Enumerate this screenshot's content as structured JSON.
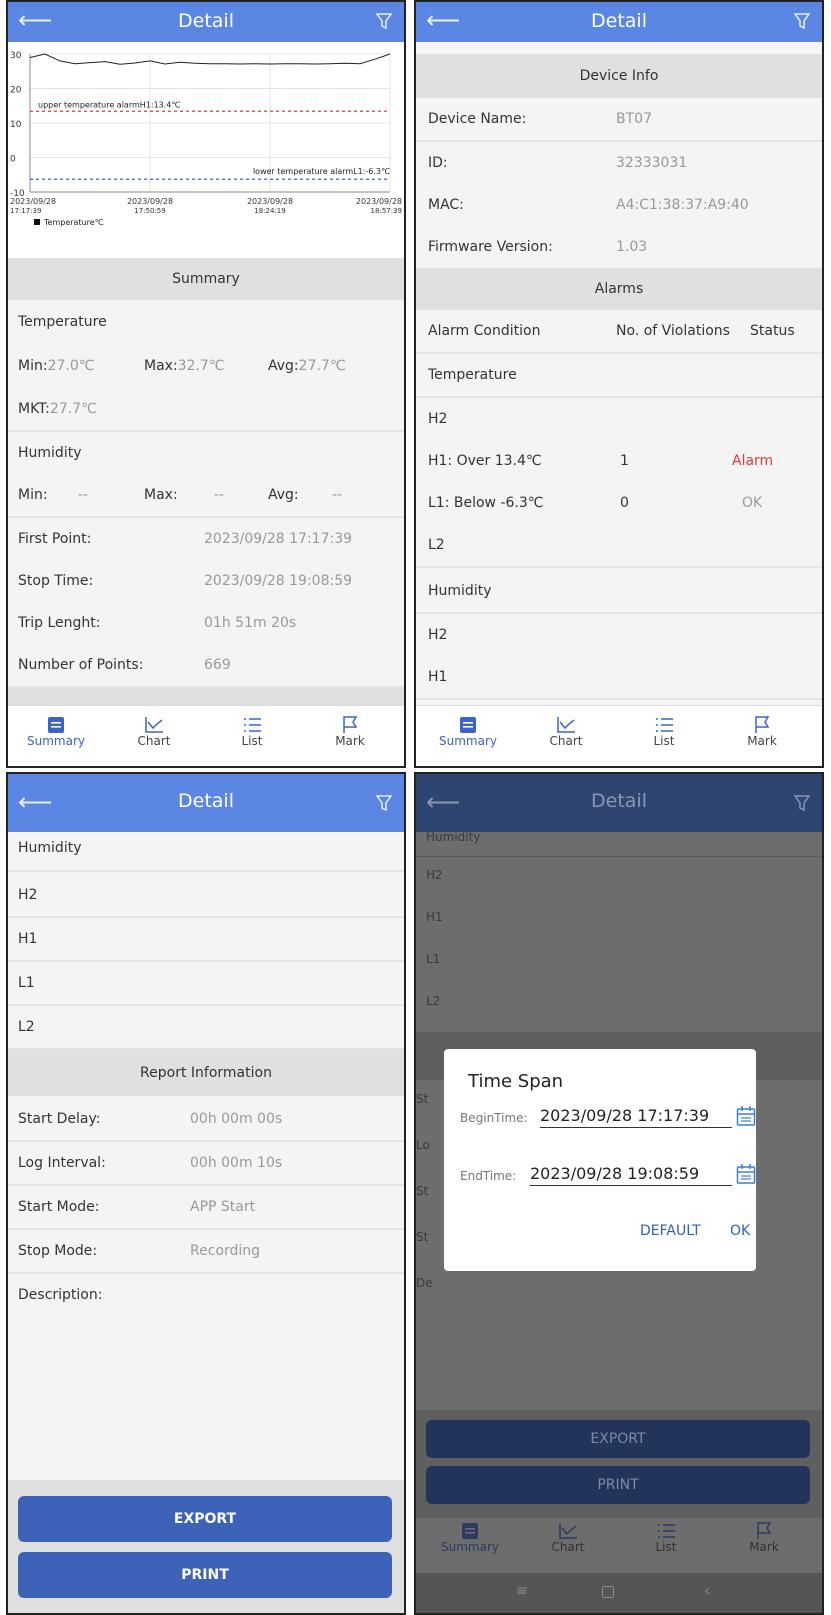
{
  "header": {
    "title": "Detail",
    "back_icon": "arrow-left-icon",
    "filter_icon": "filter-icon",
    "bg": "#5b86e3"
  },
  "chart_data": {
    "type": "line",
    "yticks": [
      "30",
      "20",
      "10",
      "0",
      "-10"
    ],
    "ylim": [
      -10,
      30
    ],
    "x_ticks": [
      {
        "date": "2023/09/28",
        "time": "17:17:39"
      },
      {
        "date": "2023/09/28",
        "time": "17:50:59"
      },
      {
        "date": "2023/09/28",
        "time": "18:24:19"
      },
      {
        "date": "2023/09/28",
        "time": "18:57:39"
      }
    ],
    "upper_alarm_label": "upper temperature alarmH1:13.4℃",
    "upper_alarm_value": 13.4,
    "lower_alarm_label": "lower temperature alarmL1:-6.3℃",
    "lower_alarm_value": -6.3,
    "legend": "Temperature℃",
    "series": [
      {
        "name": "Temperature℃",
        "values": [
          29,
          30,
          28,
          27.2,
          27.5,
          27.8,
          27,
          27.4,
          28,
          27.1,
          27.6,
          27.3,
          27.2,
          27.2,
          27.1,
          27.2,
          27.1,
          27.2,
          27.2,
          27.1,
          27.2,
          27.3,
          27.2,
          28.5,
          30
        ]
      }
    ]
  },
  "summary": {
    "section": "Summary",
    "temperature_title": "Temperature",
    "temp_min": "Min:",
    "temp_min_val": "27.0℃",
    "temp_max": "Max:",
    "temp_max_val": "32.7℃",
    "temp_avg": "Avg:",
    "temp_avg_val": "27.7℃",
    "mkt": "MKT:",
    "mkt_val": "27.7℃",
    "humidity_title": "Humidity",
    "hum_min": "Min:",
    "hum_min_val": "--",
    "hum_max": "Max:",
    "hum_max_val": "--",
    "hum_avg": "Avg:",
    "hum_avg_val": "--",
    "first_point": "First Point:",
    "first_point_val": "2023/09/28 17:17:39",
    "stop_time": "Stop Time:",
    "stop_time_val": "2023/09/28 19:08:59",
    "trip_length": "Trip Lenght:",
    "trip_length_val": "01h 51m 20s",
    "num_points": "Number of Points:",
    "num_points_val": "669"
  },
  "nav": {
    "summary": "Summary",
    "chart": "Chart",
    "list": "List",
    "mark": "Mark",
    "active_color": "#3d63c8"
  },
  "device": {
    "section": "Device Info",
    "name_label": "Device Name:",
    "name_val": "BT07",
    "id_label": "ID:",
    "id_val": "32333031",
    "mac_label": "MAC:",
    "mac_val": "A4:C1:38:37:A9:40",
    "fw_label": "Firmware Version:",
    "fw_val": "1.03"
  },
  "alarms": {
    "section": "Alarms",
    "col_condition": "Alarm Condition",
    "col_violations": "No. of Violations",
    "col_status": "Status",
    "temperature": "Temperature",
    "h2": "H2",
    "h1": "H1: Over 13.4℃",
    "h1_count": "1",
    "h1_status": "Alarm",
    "l1": "L1: Below -6.3℃",
    "l1_count": "0",
    "l1_status": "OK",
    "l2": "L2",
    "humidity": "Humidity",
    "hum_h2": "H2",
    "hum_h1": "H1",
    "alarm_color": "#e53935"
  },
  "report": {
    "humidity": "Humidity",
    "h2": "H2",
    "h1": "H1",
    "l1": "L1",
    "l2": "L2",
    "section": "Report Information",
    "start_delay": "Start Delay:",
    "start_delay_val": "00h 00m 00s",
    "log_interval": "Log Interval:",
    "log_interval_val": "00h 00m 10s",
    "start_mode": "Start Mode:",
    "start_mode_val": "APP Start",
    "stop_mode": "Stop Mode:",
    "stop_mode_val": "Recording",
    "description": "Description:",
    "export": "EXPORT",
    "print": "PRINT"
  },
  "dialog": {
    "title": "Time Span",
    "begin_label": "BeginTime:",
    "begin_val": "2023/09/28 17:17:39",
    "end_label": "EndTime:",
    "end_val": "2023/09/28 19:08:59",
    "default_btn": "DEFAULT",
    "ok_btn": "OK",
    "bg_left": [
      "St",
      "Lo",
      "St",
      "St",
      "De"
    ]
  }
}
